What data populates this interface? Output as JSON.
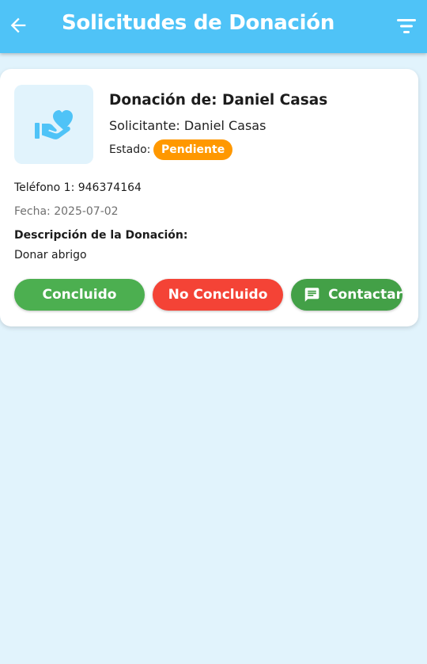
{
  "header": {
    "title": "Solicitudes de Donación",
    "background_color": "#4fc3f7",
    "back_icon": "arrow-left-icon",
    "filter_icon": "filter-list-icon"
  },
  "card": {
    "icon": "volunteer-activism-icon",
    "title": "Donación de: Daniel Casas",
    "requester": "Solicitante: Daniel Casas",
    "status_label": "Estado:",
    "status_value": "Pendiente",
    "status_color": "#ff9800",
    "phone": "Teléfono 1: 946374164",
    "date": "Fecha: 2025-07-02",
    "description_heading": "Descripción de la Donación:",
    "description": "Donar abrigo",
    "buttons": {
      "concluded": {
        "label": "Concluido",
        "color": "#4caf50"
      },
      "not_concluded": {
        "label": "No Concluido",
        "color": "#f44336"
      },
      "contact": {
        "label": "Contactar",
        "color": "#43a047",
        "icon": "chat-icon"
      }
    }
  },
  "page_background": "#e1f3fc"
}
